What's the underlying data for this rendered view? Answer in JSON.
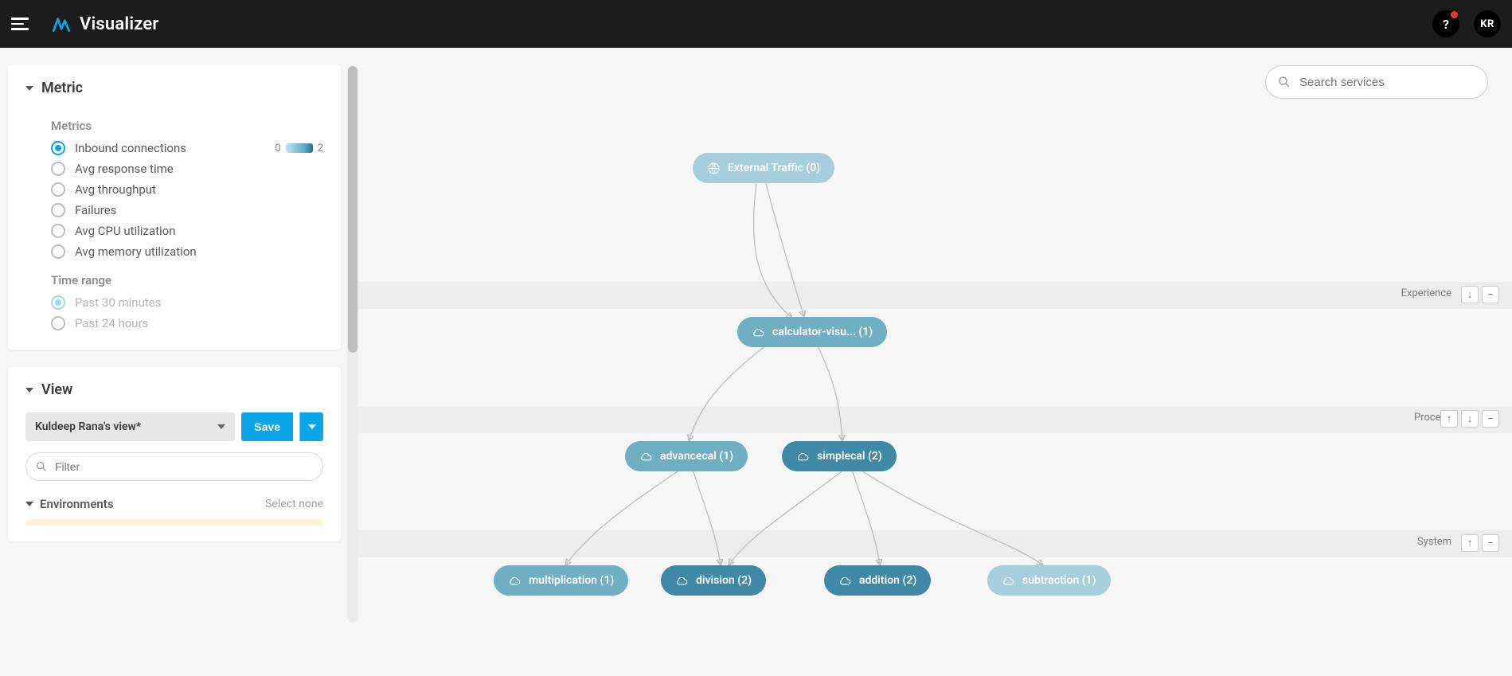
{
  "header": {
    "title": "Visualizer",
    "help_symbol": "?",
    "avatar_initials": "KR"
  },
  "sidebar": {
    "metric": {
      "title": "Metric",
      "metrics_heading": "Metrics",
      "options": [
        "Inbound connections",
        "Avg response time",
        "Avg throughput",
        "Failures",
        "Avg CPU utilization",
        "Avg memory utilization"
      ],
      "selected_index": 0,
      "scale_min": "0",
      "scale_max": "2",
      "time_heading": "Time range",
      "time_options": [
        "Past 30 minutes",
        "Past 24 hours"
      ],
      "time_selected_index": 0
    },
    "view": {
      "title": "View",
      "selected_view": "Kuldeep Rana's view*",
      "save_label": "Save",
      "filter_placeholder": "Filter",
      "env_label": "Environments",
      "select_none": "Select none"
    }
  },
  "canvas": {
    "search_placeholder": "Search services",
    "layers": {
      "experience": "Experience",
      "process": "Process",
      "system": "System"
    },
    "nodes": {
      "external": {
        "label": "External Traffic (0)"
      },
      "calculator": {
        "label": "calculator-visu... (1)"
      },
      "advancecal": {
        "label": "advancecal (1)"
      },
      "simplecal": {
        "label": "simplecal (2)"
      },
      "multiplication": {
        "label": "multiplication (1)"
      },
      "division": {
        "label": "division (2)"
      },
      "addition": {
        "label": "addition (2)"
      },
      "subtraction": {
        "label": "subtraction (1)"
      }
    }
  }
}
